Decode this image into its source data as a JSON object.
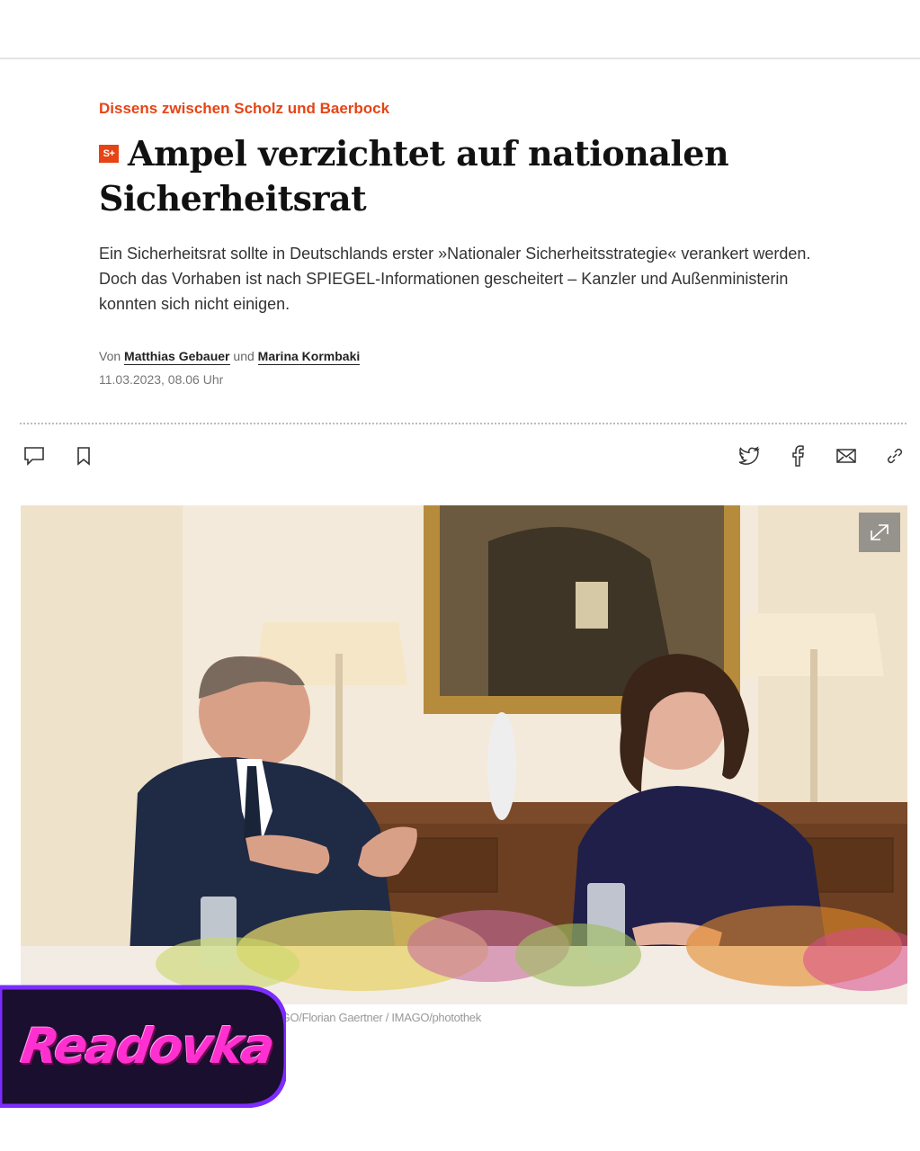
{
  "article": {
    "kicker": "Dissens zwischen Scholz und Baerbock",
    "badge": "S+",
    "headline": "Ampel verzichtet auf nationalen Sicherheitsrat",
    "teaser": "Ein Sicherheitsrat sollte in Deutschlands erster »Nationaler Sicherheitsstrategie« verankert werden. Doch das Vorhaben ist nach SPIEGEL-Informationen gescheitert – Kanzler und Außenministerin konnten sich nicht einigen.",
    "byline_prefix": "Von",
    "author1": "Matthias Gebauer",
    "byline_and": "und",
    "author2": "Marina Kormbaki",
    "date": "11.03.2023, 08.06 Uhr"
  },
  "toolbar": {
    "left_icons": [
      "comment-icon",
      "bookmark-icon"
    ],
    "share_icons": [
      "twitter-icon",
      "facebook-icon",
      "mail-icon",
      "link-icon"
    ]
  },
  "image": {
    "caption": "Kanzler Scholz, Außenministerin Baerbock Foto: IMAGO/Florian Gaertner / IMAGO/photothek"
  },
  "watermark": {
    "text": "Readovka"
  },
  "colors": {
    "accent": "#e64415",
    "watermark_pink": "#ff2fd0",
    "watermark_dark": "#1a0f2e"
  }
}
